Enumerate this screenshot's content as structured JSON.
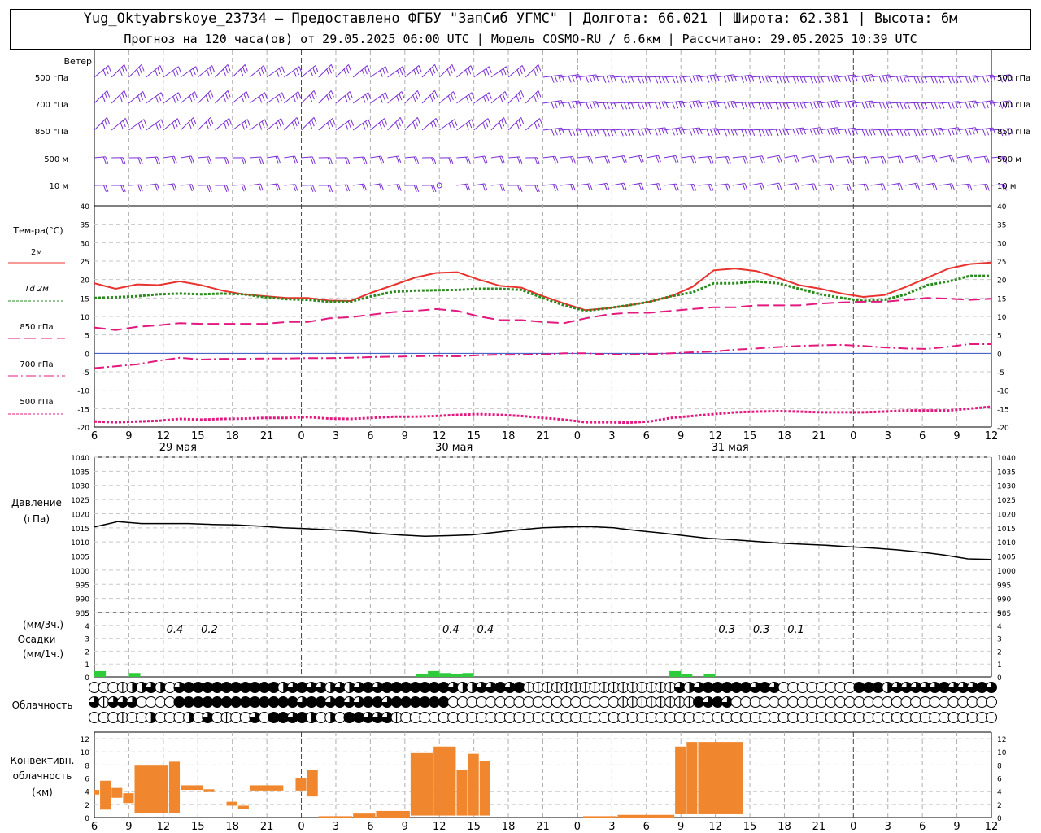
{
  "header": {
    "line1": "Yug_Oktyabrskoye_23734 – Предоставлено ФГБУ \"ЗапСиб УГМС\" | Долгота: 66.021 | Широта: 62.381 | Высота: 6м",
    "line2": "Прогноз на 120 часа(ов) от 29.05.2025 06:00 UTC  | Модель COSMO-RU / 6.6км | Рассчитано: 29.05.2025 10:39 UTC"
  },
  "chart_data": {
    "type": "line",
    "x": {
      "unit": "hours since 29.05.2025 06:00 UTC",
      "tick_labels": [
        "6",
        "9",
        "12",
        "15",
        "18",
        "21",
        "0",
        "3",
        "6",
        "9",
        "12",
        "15",
        "18",
        "21",
        "0",
        "3",
        "6",
        "9",
        "12",
        "15",
        "18",
        "21",
        "0",
        "3",
        "6",
        "9",
        "12"
      ],
      "day_labels": [
        "29 мая",
        "30 мая",
        "31 мая"
      ]
    },
    "wind": {
      "label": "Ветер",
      "levels": [
        "500 гПа",
        "700 гПа",
        "850 гПа",
        "500 м",
        "10 м"
      ]
    },
    "temperature": {
      "ylabel": "Тем-ра(°C)",
      "ylim": [
        -20,
        40
      ],
      "ticks": [
        "40",
        "35",
        "30",
        "25",
        "20",
        "15",
        "10",
        "5",
        "0",
        "-5",
        "-10",
        "-15",
        "-20"
      ],
      "series": [
        {
          "name": "2м",
          "color": "#e8332e",
          "style": "solid",
          "values": [
            19,
            17.5,
            18.7,
            18.5,
            19.5,
            18.5,
            17,
            16,
            15.5,
            15,
            15,
            14.3,
            14.2,
            16.5,
            18.5,
            20.5,
            21.8,
            22,
            20,
            18.3,
            17.8,
            15.5,
            13.5,
            11.7,
            12.2,
            13,
            14,
            15.5,
            18,
            22.5,
            23,
            22.3,
            20.5,
            18.5,
            17.5,
            16.2,
            15.3,
            15.8,
            18,
            20.5,
            23,
            24.2,
            24.6
          ]
        },
        {
          "name": "Td 2м",
          "color": "#2a8a1e",
          "style": "dotted",
          "values": [
            15,
            15.2,
            15.5,
            16,
            16.2,
            16,
            16.2,
            16,
            15.2,
            14.7,
            14.5,
            14,
            14,
            15.5,
            16.7,
            17,
            17.1,
            17.2,
            17.5,
            17.5,
            17.2,
            15,
            13,
            11.5,
            12.2,
            13,
            14,
            15.5,
            16.5,
            19,
            19,
            19.5,
            19,
            17.5,
            16,
            15,
            14.2,
            14.5,
            16,
            18.5,
            19.5,
            21,
            21
          ]
        },
        {
          "name": "850 гПа",
          "color": "#e4197f",
          "style": "longdash",
          "values": [
            7,
            6.3,
            7.2,
            7.6,
            8.2,
            8,
            8,
            8,
            8,
            8.5,
            8.5,
            9.5,
            9.8,
            10.5,
            11.2,
            11.5,
            12,
            11.5,
            10,
            9,
            9,
            8.5,
            8.2,
            9.5,
            10.5,
            11,
            11,
            11.5,
            12,
            12.5,
            12.5,
            13,
            13,
            13,
            13.5,
            13.8,
            14,
            14,
            14.5,
            15,
            14.8,
            14.5,
            14.8
          ]
        },
        {
          "name": "700 гПа",
          "color": "#e4197f",
          "style": "dashdot",
          "values": [
            -4,
            -3.5,
            -3,
            -2,
            -1.2,
            -1.7,
            -1.5,
            -1.5,
            -1.4,
            -1.4,
            -1.3,
            -1.3,
            -1.2,
            -1,
            -0.9,
            -0.8,
            -0.7,
            -0.8,
            -0.5,
            -0.4,
            -0.4,
            -0.3,
            0,
            0,
            -0.3,
            -0.4,
            -0.2,
            0,
            0.3,
            0.5,
            1,
            1.3,
            1.7,
            2,
            2.2,
            2.3,
            2,
            1.6,
            1.3,
            1.2,
            1.8,
            2.5,
            2.5
          ]
        },
        {
          "name": "500 гПа",
          "color": "#e4197f",
          "style": "dotted",
          "values": [
            -18.5,
            -18.7,
            -18.5,
            -18.3,
            -17.8,
            -18,
            -17.8,
            -17.7,
            -17.5,
            -17.5,
            -17.3,
            -17.7,
            -17.8,
            -17.5,
            -17.2,
            -17.2,
            -17,
            -16.7,
            -16.5,
            -16.7,
            -17,
            -17.5,
            -18,
            -18.7,
            -18.7,
            -18.8,
            -18.5,
            -17.5,
            -17,
            -16.5,
            -16,
            -15.8,
            -15.7,
            -15.8,
            -16,
            -16,
            -16,
            -15.8,
            -15.5,
            -15.5,
            -15.5,
            -15,
            -14.5
          ]
        }
      ]
    },
    "pressure": {
      "ylabel": "Давление\n(гПа)",
      "ylim": [
        985,
        1040
      ],
      "ticks": [
        "1040",
        "1035",
        "1030",
        "1025",
        "1020",
        "1015",
        "1010",
        "1005",
        "1000",
        "995",
        "990",
        "985"
      ],
      "series": [
        {
          "name": "Давление",
          "color": "#000000",
          "values": [
            1015.3,
            1017.2,
            1016.5,
            1016.5,
            1016.5,
            1016.2,
            1016,
            1015.6,
            1015,
            1014.7,
            1014.3,
            1013.8,
            1013,
            1012.4,
            1012,
            1012.2,
            1012.5,
            1013.4,
            1014.3,
            1015,
            1015.3,
            1015.4,
            1015,
            1014,
            1013.2,
            1012.2,
            1011.3,
            1010.8,
            1010.2,
            1009.6,
            1009.2,
            1008.8,
            1008.3,
            1007.8,
            1007.2,
            1006.4,
            1005.4,
            1004,
            1003.8
          ]
        }
      ]
    },
    "precip": {
      "ylabel_top": "(мм/3ч.)",
      "ylabel_mid": "Осадки",
      "ylabel_bot": "(мм/1ч.)",
      "ticks": [
        "5",
        "4",
        "3",
        "2",
        "1",
        "0"
      ],
      "labels": [
        {
          "x_hour": 7,
          "text": "0.4"
        },
        {
          "x_hour": 10,
          "text": "0.2"
        },
        {
          "x_hour": 31,
          "text": "0.4"
        },
        {
          "x_hour": 34,
          "text": "0.4"
        },
        {
          "x_hour": 55,
          "text": "0.3"
        },
        {
          "x_hour": 58,
          "text": "0.3"
        },
        {
          "x_hour": 61,
          "text": "0.1"
        }
      ],
      "hourly_mm": [
        {
          "h": 0,
          "v": 0.45
        },
        {
          "h": 3,
          "v": 0.3
        },
        {
          "h": 28,
          "v": 0.2
        },
        {
          "h": 29,
          "v": 0.45
        },
        {
          "h": 30,
          "v": 0.3
        },
        {
          "h": 31,
          "v": 0.2
        },
        {
          "h": 32,
          "v": 0.3
        },
        {
          "h": 50,
          "v": 0.45
        },
        {
          "h": 51,
          "v": 0.2
        },
        {
          "h": 53,
          "v": 0.2
        }
      ],
      "color": "#2ecc3a"
    },
    "clouds": {
      "label": "Облачность",
      "scale": "0-4 (0=clear, 4=overcast)",
      "rows": [
        "000122320344444444442343323234344444443223343411111111111111113234444434300000000444233333433343",
        "313330000444444444444434434334434444440000000000000000001111111143430000000000000000000000000000",
        "000100200020301003044342020443331000000000000000000000000000000000000000000000000000000000000000"
      ]
    },
    "convective": {
      "ylabel": "Конвективн.\nоблачность\n(км)",
      "ylim": [
        0,
        13
      ],
      "ticks": [
        "12",
        "10",
        "8",
        "6",
        "4",
        "2",
        "0"
      ],
      "color": "#f0872e",
      "bars": [
        {
          "h0": 0,
          "h1": 0.5,
          "b": 3.5,
          "t": 4.2
        },
        {
          "h0": 0.5,
          "h1": 1.5,
          "b": 1.2,
          "t": 5.6
        },
        {
          "h0": 1.5,
          "h1": 2.5,
          "b": 3,
          "t": 4.5
        },
        {
          "h0": 2.5,
          "h1": 3.5,
          "b": 2.2,
          "t": 3.7
        },
        {
          "h0": 3.5,
          "h1": 6.5,
          "b": 0.7,
          "t": 7.9
        },
        {
          "h0": 6.5,
          "h1": 7.5,
          "b": 0.7,
          "t": 8.5
        },
        {
          "h0": 7.5,
          "h1": 9.5,
          "b": 4.2,
          "t": 4.9
        },
        {
          "h0": 9.5,
          "h1": 10.5,
          "b": 4,
          "t": 4.3
        },
        {
          "h0": 11.5,
          "h1": 12.5,
          "b": 1.8,
          "t": 2.4
        },
        {
          "h0": 12.5,
          "h1": 13.5,
          "b": 1.3,
          "t": 1.8
        },
        {
          "h0": 13.5,
          "h1": 16.5,
          "b": 4.1,
          "t": 4.9
        },
        {
          "h0": 17.5,
          "h1": 18.5,
          "b": 4.1,
          "t": 6
        },
        {
          "h0": 18.5,
          "h1": 19.5,
          "b": 3.2,
          "t": 7.3
        },
        {
          "h0": 19.5,
          "h1": 22.5,
          "b": 0,
          "t": 0.2
        },
        {
          "h0": 22.5,
          "h1": 24.5,
          "b": 0,
          "t": 0.6
        },
        {
          "h0": 24.5,
          "h1": 27.5,
          "b": 0,
          "t": 1
        },
        {
          "h0": 27.5,
          "h1": 29.5,
          "b": 0.3,
          "t": 9.8
        },
        {
          "h0": 29.5,
          "h1": 31.5,
          "b": 0.3,
          "t": 10.8
        },
        {
          "h0": 31.5,
          "h1": 32.5,
          "b": 0.3,
          "t": 7.2
        },
        {
          "h0": 32.5,
          "h1": 33.5,
          "b": 0.3,
          "t": 9.7
        },
        {
          "h0": 33.5,
          "h1": 34.5,
          "b": 0.3,
          "t": 8.6
        },
        {
          "h0": 42.5,
          "h1": 45.5,
          "b": 0,
          "t": 0.2
        },
        {
          "h0": 45.5,
          "h1": 50.5,
          "b": 0,
          "t": 0.4
        },
        {
          "h0": 50.5,
          "h1": 51.5,
          "b": 0.5,
          "t": 10.8
        },
        {
          "h0": 51.5,
          "h1": 52.5,
          "b": 0.5,
          "t": 11.5
        },
        {
          "h0": 52.5,
          "h1": 56.5,
          "b": 0.5,
          "t": 11.5
        }
      ]
    }
  }
}
